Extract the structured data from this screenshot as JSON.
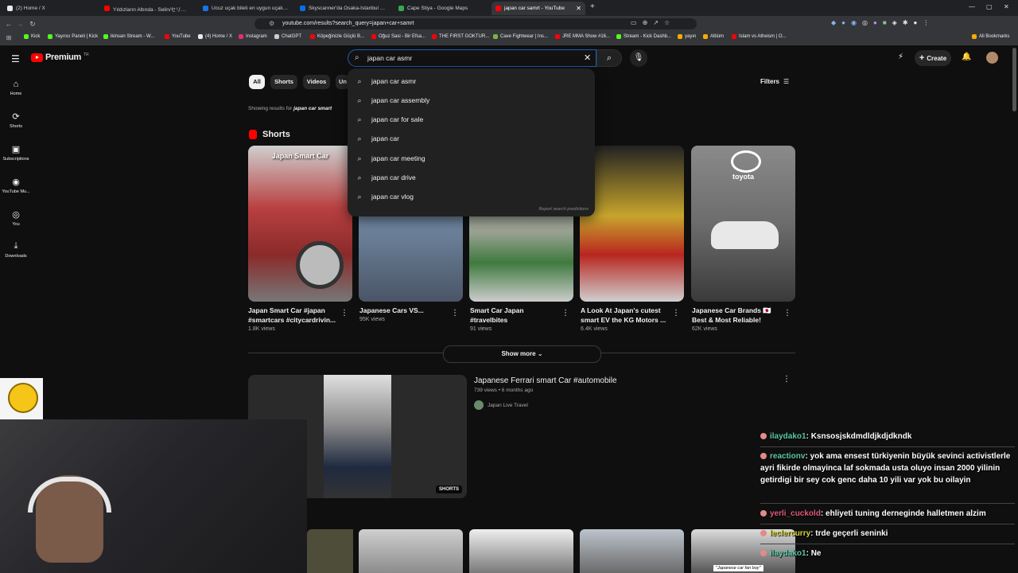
{
  "browser": {
    "tabs": [
      {
        "title": "(2) Home / X",
        "color": "#e8eaed"
      },
      {
        "title": "Yıldızların Altında - Selin/セリン [cove",
        "color": "#ff0000"
      },
      {
        "title": "Ucuz uçak bileti en uygun uçak bilet",
        "color": "#1a73e8"
      },
      {
        "title": "Skyscanner'da Osaka-İstanbul arası u",
        "color": "#0770e3"
      },
      {
        "title": "Cape Stiya - Google Maps",
        "color": "#34a853"
      },
      {
        "title": "japan car samrt - YouTube",
        "color": "#ff0000"
      }
    ],
    "new_tab": "+",
    "url": "youtube.com/results?search_query=japan+car+samrt",
    "bookmarks": [
      {
        "label": "Kick",
        "color": "#53fc18"
      },
      {
        "label": "Yayıncı Paneli | Kick",
        "color": "#53fc18"
      },
      {
        "label": "ikinsan Stream - W...",
        "color": "#53fc18"
      },
      {
        "label": "YouTube",
        "color": "#ff0000"
      },
      {
        "label": "(4) Home / X",
        "color": "#e8eaed"
      },
      {
        "label": "Instagram",
        "color": "#e1306c"
      },
      {
        "label": "ChatGPT",
        "color": "#cccccc"
      },
      {
        "label": "Köpeğinizle Güçlü B...",
        "color": "#ff0000"
      },
      {
        "label": "Oğuz Sasi - Bir Efsa...",
        "color": "#ff0000"
      },
      {
        "label": "THE FIRST GOKTUR...",
        "color": "#ff0000"
      },
      {
        "label": "Cave Fightwear | Ins...",
        "color": "#7cb342"
      },
      {
        "label": "JRE MMA Show #16...",
        "color": "#ff0000"
      },
      {
        "label": "Stream - Kick Dashb...",
        "color": "#53fc18"
      },
      {
        "label": "yayın",
        "color": "#f9ab00"
      },
      {
        "label": "Albüm",
        "color": "#f9ab00"
      },
      {
        "label": "Islam vs Atheism | O...",
        "color": "#ff0000"
      }
    ],
    "all_bookmarks": "All Bookmarks"
  },
  "youtube": {
    "logo_text": "Premium",
    "logo_sup": "TR",
    "search_value": "japan car asmr",
    "create_label": "Create",
    "sidebar": [
      {
        "label": "Home",
        "icon": "home-icon",
        "glyph": "⌂"
      },
      {
        "label": "Shorts",
        "icon": "shorts-icon",
        "glyph": "⟳"
      },
      {
        "label": "Subscriptions",
        "icon": "subscriptions-icon",
        "glyph": "▣"
      },
      {
        "label": "YouTube Mu...",
        "icon": "music-icon",
        "glyph": "◉"
      },
      {
        "label": "You",
        "icon": "you-icon",
        "glyph": "◎"
      },
      {
        "label": "Downloads",
        "icon": "download-icon",
        "glyph": "⤓"
      }
    ],
    "chips": [
      "All",
      "Shorts",
      "Videos",
      "Un"
    ],
    "filters_label": "Filters",
    "showing_prefix": "Showing results for",
    "showing_query": "japan car smart",
    "suggestions": [
      "japan car asmr",
      "japan car assembly",
      "japan car for sale",
      "japan car",
      "japan car meeting",
      "japan car drive",
      "japan car vlog"
    ],
    "report_predictions": "Report search predictions",
    "shorts_heading": "Shorts",
    "shorts": [
      {
        "title": "Japan Smart Car #japan #smartcars #citycardrivin...",
        "views": "1.8K views",
        "overlay": "Japan Smart Car",
        "bg": "#a23a3a"
      },
      {
        "title": "Japanese Cars VS...",
        "views": "95K views",
        "overlay": "",
        "bg": "#6f86a0"
      },
      {
        "title": "Smart Car Japan #travelbites",
        "views": "91 views",
        "overlay": "",
        "bg": "#9ca394"
      },
      {
        "title": "A Look At Japan's cutest smart EV  the KG Motors ...",
        "views": "6.4K views",
        "overlay": "",
        "bg": "#c7a52c"
      },
      {
        "title": "Japanese Car Brands 🇯🇵 Best & Most Reliable!",
        "views": "62K views",
        "overlay": "toyota",
        "bg": "#6c6c6c"
      }
    ],
    "show_more": "Show more",
    "video": {
      "title": "Japanese Ferrari smart Car #automobile",
      "meta": "739 views • 6 months ago",
      "channel": "Japan Live Travel",
      "badge": "SHORTS"
    },
    "bottom_caption": "\"Japanese car fan boy\""
  },
  "chat": [
    {
      "user": "ilaydako1",
      "color": "#5bc8a8",
      "text": "Ksnsosjskdmdldjkdjdkndk"
    },
    {
      "user": "reactionv",
      "color": "#5bc8a8",
      "text": "yok ama ensest türkiyenin büyük sevinci activistlerle ayri fikirde olmayinca laf sokmada usta oluyo insan 2000 yilinin getirdigi bir sey cok genc daha 10 yili var yok bu oilayin"
    },
    {
      "user": "yerli_cuckold",
      "color": "#e05a7a",
      "text": "ehliyeti tuning derneginde halletmen alzim"
    },
    {
      "user": "leclercurry",
      "color": "#d6d63a",
      "text": "trde geçerli seninki"
    },
    {
      "user": "ilaydako1",
      "color": "#5bc8a8",
      "text": "Ne"
    }
  ]
}
